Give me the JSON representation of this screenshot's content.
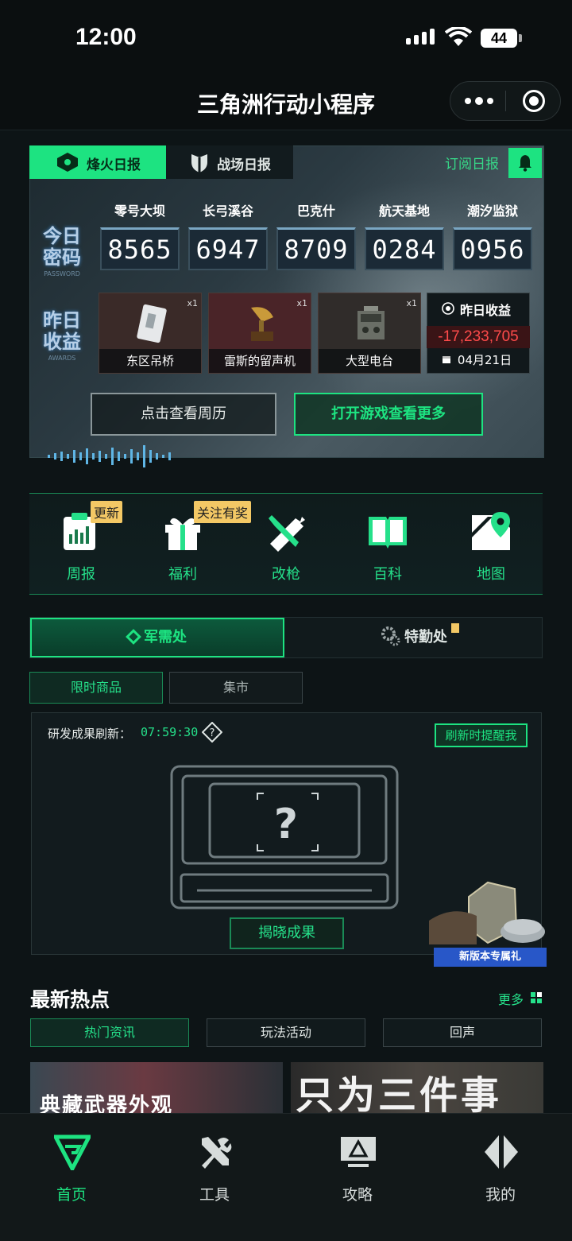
{
  "status_bar": {
    "time": "12:00",
    "battery": "44"
  },
  "title_bar": {
    "title": "三角洲行动小程序"
  },
  "report": {
    "tabs": [
      "烽火日报",
      "战场日报"
    ],
    "subscribe_label": "订阅日报",
    "code_label": "今日\n密码",
    "code_sub": "PASSWORD",
    "maps": [
      {
        "name": "零号大坝",
        "code": "8565"
      },
      {
        "name": "长弓溪谷",
        "code": "6947"
      },
      {
        "name": "巴克什",
        "code": "8709"
      },
      {
        "name": "航天基地",
        "code": "0284"
      },
      {
        "name": "潮汐监狱",
        "code": "0956"
      }
    ],
    "earn_label": "昨日\n收益",
    "earn_sub": "AWARDS",
    "items": [
      {
        "name": "东区吊桥",
        "qty": "x1"
      },
      {
        "name": "雷斯的留声机",
        "qty": "x1"
      },
      {
        "name": "大型电台",
        "qty": "x1"
      }
    ],
    "earnings": {
      "title": "昨日收益",
      "value": "-17,233,705",
      "date": "04月21日"
    },
    "btn_calendar": "点击查看周历",
    "btn_open_game": "打开游戏查看更多"
  },
  "tools": [
    {
      "label": "周报",
      "badge": "更新",
      "icon": "report-chart-icon"
    },
    {
      "label": "福利",
      "badge": "关注有奖",
      "icon": "gift-icon"
    },
    {
      "label": "改枪",
      "badge": "",
      "icon": "gun-wrench-icon"
    },
    {
      "label": "百科",
      "badge": "",
      "icon": "book-icon"
    },
    {
      "label": "地图",
      "badge": "",
      "icon": "map-pin-icon"
    }
  ],
  "shop": {
    "tabs": [
      "军需处",
      "特勤处"
    ],
    "subtabs": [
      "限时商品",
      "集市"
    ],
    "refresh_label": "研发成果刷新：",
    "refresh_time": "07:59:30",
    "remind_label": "刷新时提醒我",
    "reveal_label": "揭晓成果",
    "gift_label": "新版本专属礼"
  },
  "hot": {
    "title": "最新热点",
    "more_label": "更多",
    "tabs": [
      "热门资讯",
      "玩法活动",
      "回声"
    ],
    "news": [
      "典藏武器外观",
      "只为三件事"
    ]
  },
  "bottom_nav": [
    {
      "label": "首页",
      "icon": "home-logo-icon"
    },
    {
      "label": "工具",
      "icon": "tools-icon"
    },
    {
      "label": "攻略",
      "icon": "guide-monitor-icon"
    },
    {
      "label": "我的",
      "icon": "profile-logo-icon"
    }
  ],
  "colors": {
    "accent": "#1de381",
    "negative": "#ff4b4b",
    "badge": "#f3c865",
    "background": "#0d1416"
  }
}
